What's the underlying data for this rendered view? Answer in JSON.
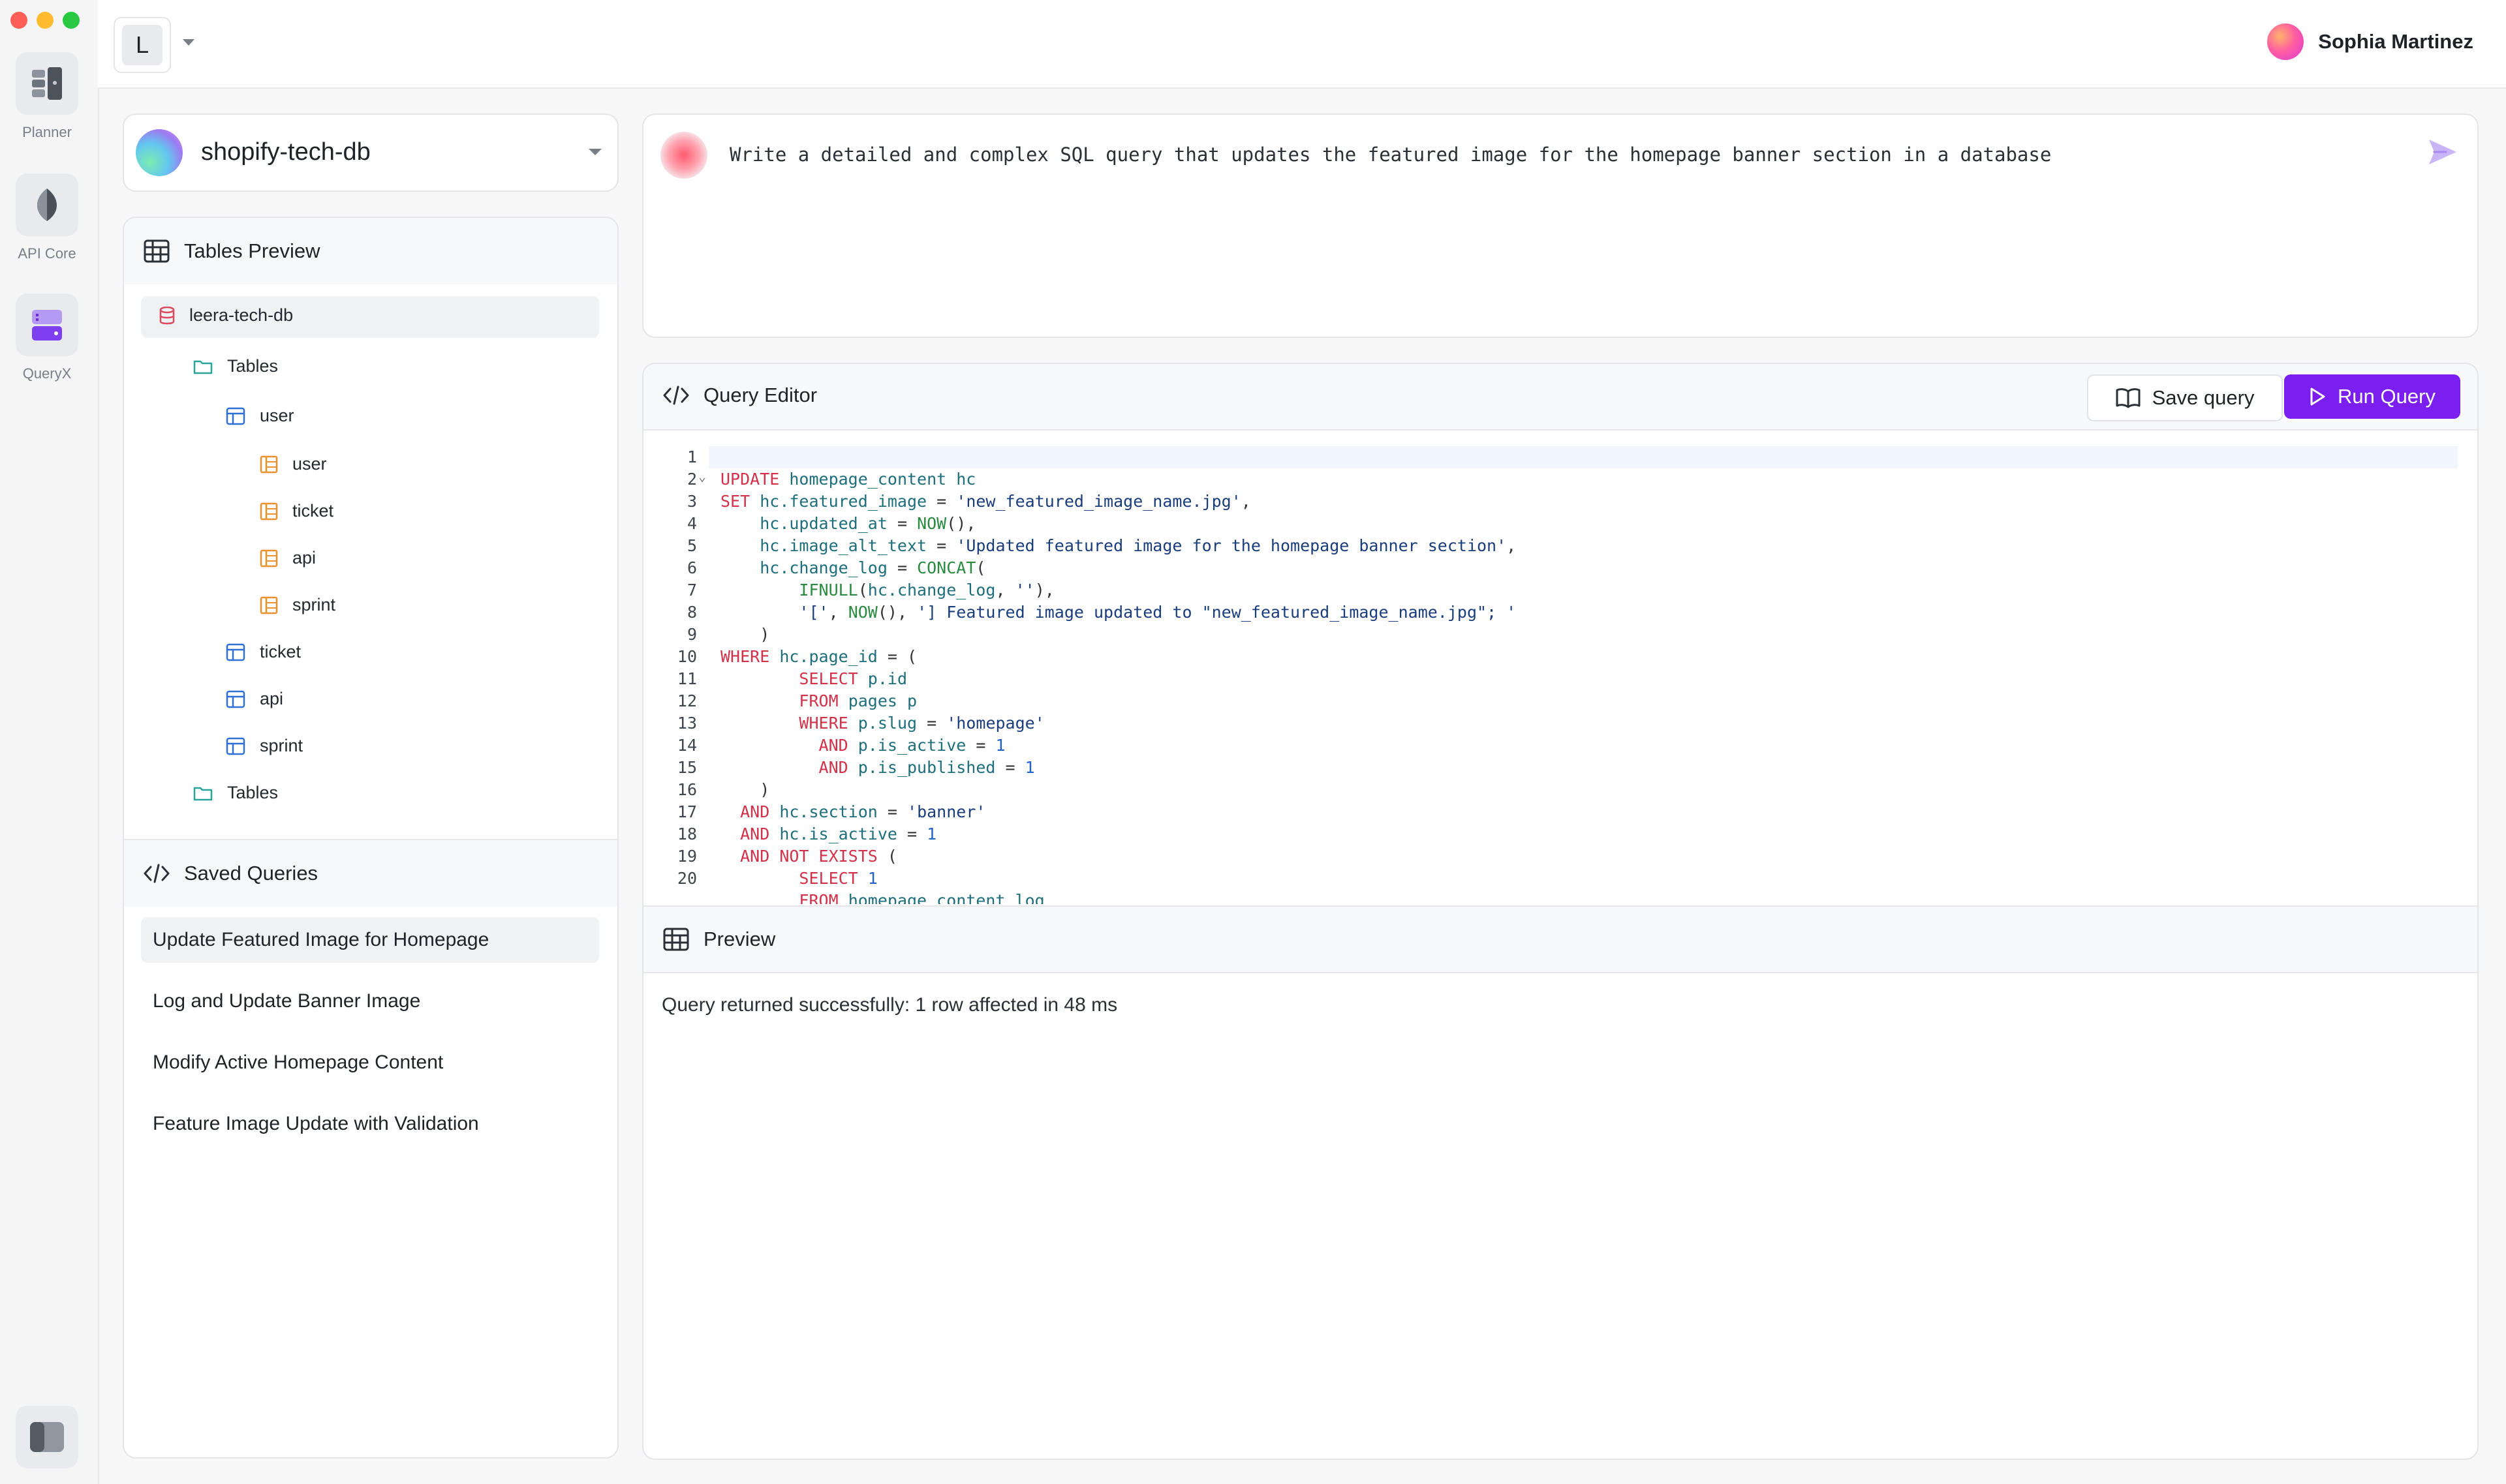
{
  "rail": {
    "items": [
      {
        "label": "Planner",
        "icon": "server-stack-icon"
      },
      {
        "label": "API Core",
        "icon": "leaf-icon"
      },
      {
        "label": "QueryX",
        "icon": "database-server-icon"
      }
    ],
    "bottom_icon": "sidebar-toggle-icon"
  },
  "topbar": {
    "workspace_initial": "L",
    "user_name": "Sophia Martinez"
  },
  "database": {
    "name": "shopify-tech-db"
  },
  "tables_preview": {
    "title": "Tables Preview",
    "tree": {
      "root": "leera-tech-db",
      "group1": "Tables",
      "user": "user",
      "user_children": [
        "user",
        "ticket",
        "api",
        "sprint"
      ],
      "tables": [
        "ticket",
        "api",
        "sprint"
      ],
      "group2": "Tables"
    }
  },
  "saved_queries": {
    "title": "Saved Queries",
    "items": [
      "Update Featured Image for Homepage",
      "Log and Update Banner Image",
      "Modify Active Homepage Content",
      "Feature Image Update with Validation"
    ]
  },
  "prompt": {
    "text": "Write a detailed and complex SQL query that updates the featured image for the homepage banner section in a database"
  },
  "editor": {
    "title": "Query Editor",
    "save_label": "Save query",
    "run_label": "Run Query",
    "line_numbers": [
      "1",
      "2",
      "3",
      "4",
      "5",
      "6",
      "7",
      "8",
      "9",
      "10",
      "11",
      "12",
      "13",
      "14",
      "15",
      "16",
      "17",
      "18",
      "19",
      "20"
    ]
  },
  "preview": {
    "title": "Preview",
    "message": "Query returned successfully: 1 row affected in 48 ms"
  },
  "colors": {
    "accent": "#7b1ff0",
    "keyword": "#d1324a",
    "function": "#2a8a40",
    "identifier": "#1e6e7b",
    "string": "#1a3d7c",
    "table_icon": "#2f6fd6",
    "column_icon": "#e8922c",
    "db_icon": "#d84a5c",
    "folder_icon": "#2aa39a"
  }
}
